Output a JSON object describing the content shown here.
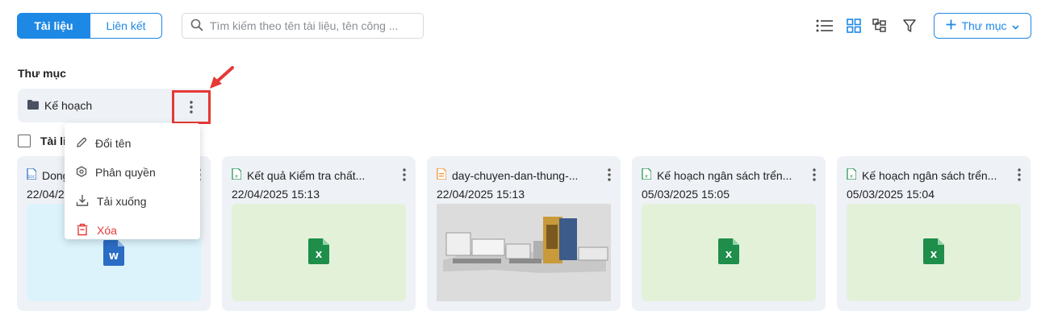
{
  "tabs": {
    "documents": "Tài liệu",
    "links": "Liên kết"
  },
  "search": {
    "placeholder": "Tìm kiếm theo tên tài liệu, tên công ..."
  },
  "toolbar": {
    "new_folder_label": "Thư mục"
  },
  "folders_section": {
    "title": "Thư mục",
    "folders": [
      {
        "name": "Kế hoạch"
      }
    ]
  },
  "documents_section": {
    "title": "Tài liệu"
  },
  "context_menu": {
    "items": [
      {
        "label": "Đổi tên",
        "icon": "edit-icon"
      },
      {
        "label": "Phân quyền",
        "icon": "permission-icon"
      },
      {
        "label": "Tải xuống",
        "icon": "download-icon"
      },
      {
        "label": "Xóa",
        "icon": "trash-icon",
        "color": "#e53935"
      }
    ]
  },
  "cards": [
    {
      "title": "Dong",
      "date": "22/04/2025",
      "type": "doc",
      "file_label": "W"
    },
    {
      "title": "Kết quả Kiểm tra chất...",
      "date": "22/04/2025 15:13",
      "type": "xlsx",
      "file_label": "X"
    },
    {
      "title": "day-chuyen-dan-thung-...",
      "date": "22/04/2025 15:13",
      "type": "image"
    },
    {
      "title": "Kế hoạch ngân sách trển...",
      "date": "05/03/2025 15:05",
      "type": "xlsx",
      "file_label": "X"
    },
    {
      "title": "Kế hoạch ngân sách trển...",
      "date": "05/03/2025 15:04",
      "type": "xlsx",
      "file_label": "X"
    }
  ],
  "colors": {
    "primary": "#1e88e5",
    "danger": "#e53935",
    "excel": "#1e8e4a",
    "word": "#2b6cc4"
  }
}
